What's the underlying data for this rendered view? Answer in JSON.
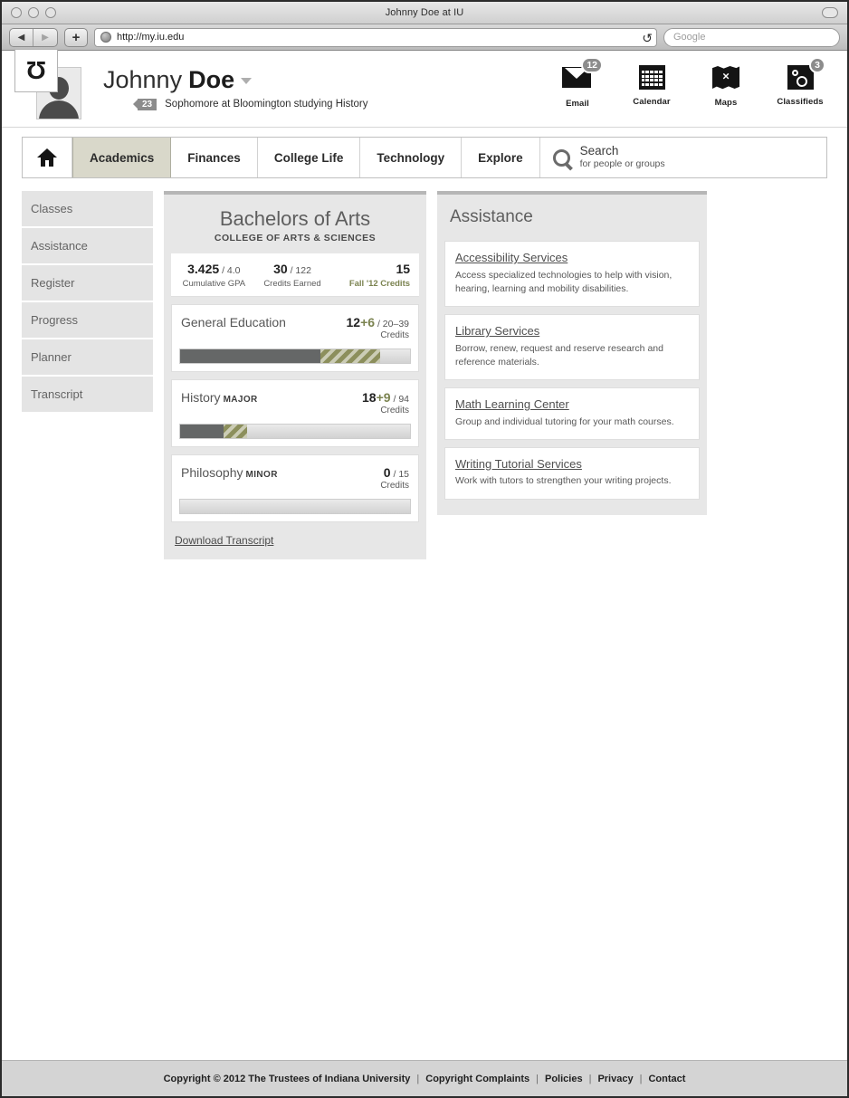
{
  "browser": {
    "window_title": "Johnny Doe at IU",
    "url": "http://my.iu.edu",
    "search_placeholder": "Google",
    "back_glyph": "◀",
    "forward_glyph": "▶",
    "plus_glyph": "+",
    "reload_glyph": "↺"
  },
  "identity": {
    "logo_text": "Ʊ",
    "first_name": "Johnny",
    "last_name": "Doe",
    "age_badge": "23",
    "subtitle": "Sophomore at Bloomington studying History"
  },
  "app_icons": [
    {
      "label": "Email",
      "badge": "12"
    },
    {
      "label": "Calendar",
      "badge": ""
    },
    {
      "label": "Maps",
      "badge": ""
    },
    {
      "label": "Classifieds",
      "badge": "3"
    }
  ],
  "nav": {
    "items": [
      {
        "label": "Academics",
        "active": true
      },
      {
        "label": "Finances",
        "active": false
      },
      {
        "label": "College Life",
        "active": false
      },
      {
        "label": "Technology",
        "active": false
      },
      {
        "label": "Explore",
        "active": false
      }
    ],
    "search_title": "Search",
    "search_subtitle": "for people or groups"
  },
  "sidebar": {
    "items": [
      {
        "label": "Classes"
      },
      {
        "label": "Assistance"
      },
      {
        "label": "Register"
      },
      {
        "label": "Progress"
      },
      {
        "label": "Planner"
      },
      {
        "label": "Transcript"
      }
    ]
  },
  "degree": {
    "title": "Bachelors of Arts",
    "subtitle": "COLLEGE OF ARTS & SCIENCES",
    "stats": [
      {
        "value": "3.425",
        "suffix": " / 4.0",
        "label": "Cumulative GPA"
      },
      {
        "value": "30",
        "suffix": " / 122",
        "label": "Credits Earned"
      },
      {
        "value": "15",
        "suffix": "",
        "label": "Fall '12 Credits"
      }
    ],
    "requirements": [
      {
        "name": "General Education",
        "tag": "",
        "earned": "12",
        "in_progress": "+6",
        "total": " / 20–39",
        "credits_label": "Credits",
        "done_pct": 61,
        "prog_pct": 26
      },
      {
        "name": "History",
        "tag": "MAJOR",
        "earned": "18",
        "in_progress": "+9",
        "total": " / 94",
        "credits_label": "Credits",
        "done_pct": 19,
        "prog_pct": 10
      },
      {
        "name": "Philosophy",
        "tag": "MINOR",
        "earned": "0",
        "in_progress": "",
        "total": " / 15",
        "credits_label": "Credits",
        "done_pct": 0,
        "prog_pct": 0
      }
    ],
    "download_label": "Download Transcript"
  },
  "assistance": {
    "title": "Assistance",
    "cards": [
      {
        "link": "Accessibility Services",
        "desc": "Access specialized technologies to help with vision, hearing, learning and mobility disabilities."
      },
      {
        "link": "Library Services",
        "desc": "Borrow, renew, request and reserve research and reference materials."
      },
      {
        "link": "Math Learning Center",
        "desc": "Group and individual tutoring for your math courses."
      },
      {
        "link": "Writing Tutorial Services",
        "desc": "Work with tutors to strengthen your writing projects."
      }
    ]
  },
  "footer": {
    "copyright": "Copyright © 2012 The Trustees of Indiana University",
    "links": [
      "Copyright Complaints",
      "Policies",
      "Privacy",
      "Contact"
    ],
    "separator": "|"
  },
  "colors": {
    "accent_olive": "#7b8350",
    "progress_done": "#656767",
    "progress_active": "#8c8f5c",
    "active_tab": "#d9d8ca"
  }
}
